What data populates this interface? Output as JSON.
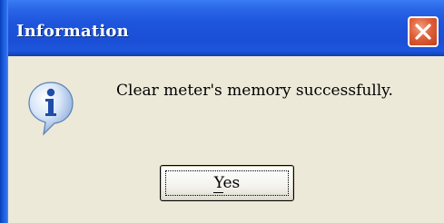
{
  "dialog": {
    "title": "Information",
    "message": "Clear meter's memory successfully.",
    "yes_label": "Yes",
    "close_icon": "close-icon",
    "info_icon": "info-icon"
  },
  "colors": {
    "titlebar": "#1a4fd6",
    "close_button": "#e0603a",
    "body": "#ece9d8"
  }
}
